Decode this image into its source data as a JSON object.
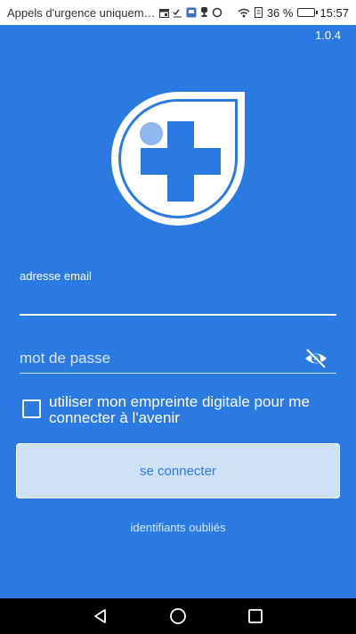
{
  "status_bar": {
    "notification": "Appels d'urgence uniquem…",
    "battery_percent": "36 %",
    "battery_level": 0.36,
    "time": "15:57"
  },
  "app": {
    "version": "1.0.4",
    "colors": {
      "primary": "#2a7ae2",
      "button_bg": "#cfe1f7",
      "logo_dot": "#8fb6ee"
    }
  },
  "login": {
    "email_label": "adresse email",
    "email_value": "",
    "password_placeholder": "mot de passe",
    "password_value": "",
    "fingerprint_label": "utiliser mon empreinte digitale pour me connecter à l'avenir",
    "fingerprint_checked": false,
    "connect_label": "se connecter",
    "forgot_label": "identifiants oubliés"
  },
  "icons": {
    "visibility": "eye-slash-icon",
    "logo": "medical-cross-logo",
    "nav_back": "back-triangle-icon",
    "nav_home": "home-circle-icon",
    "nav_recents": "recents-square-icon"
  }
}
